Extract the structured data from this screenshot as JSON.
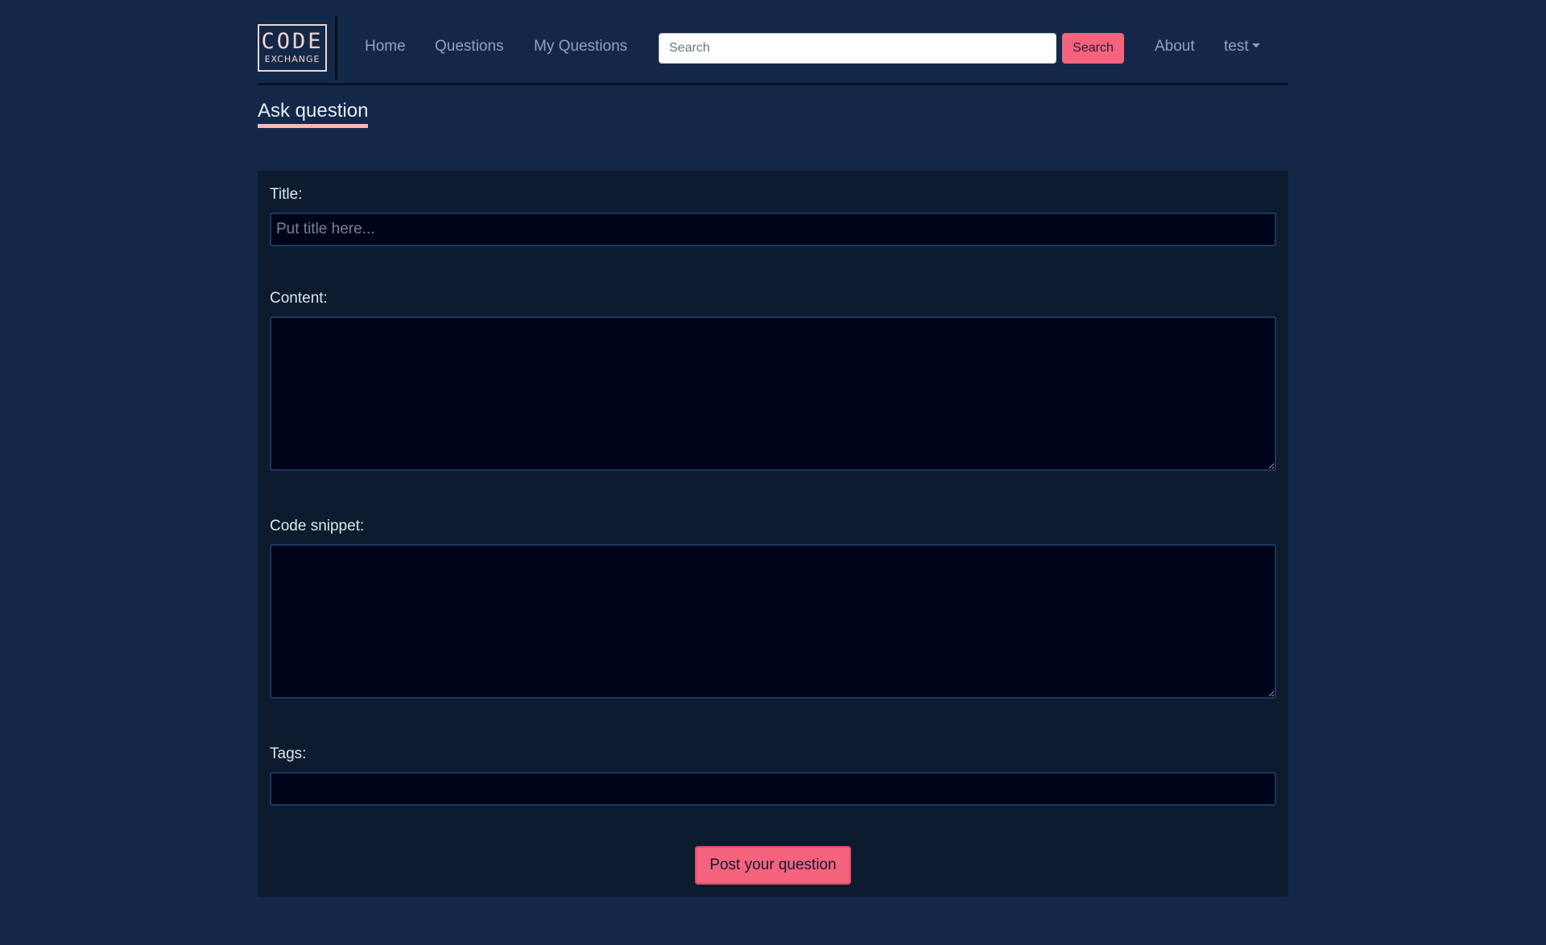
{
  "header": {
    "logo": {
      "line1": "CODE",
      "line2": "EXCHANGE"
    },
    "nav": {
      "home": "Home",
      "questions": "Questions",
      "my_questions": "My Questions",
      "about": "About",
      "user": "test"
    },
    "search": {
      "placeholder": "Search",
      "button_label": "Search"
    }
  },
  "page": {
    "title": "Ask question"
  },
  "form": {
    "title_label": "Title:",
    "title_placeholder": "Put title here...",
    "title_value": "",
    "content_label": "Content:",
    "content_value": "",
    "code_label": "Code snippet:",
    "code_value": "",
    "tags_label": "Tags:",
    "tags_value": "",
    "submit_label": "Post your question"
  },
  "colors": {
    "background": "#132849",
    "card": "#0c1b2e",
    "accent": "#f5637d",
    "underline": "#f7b9b2",
    "nav_text": "#8fa3c0"
  }
}
